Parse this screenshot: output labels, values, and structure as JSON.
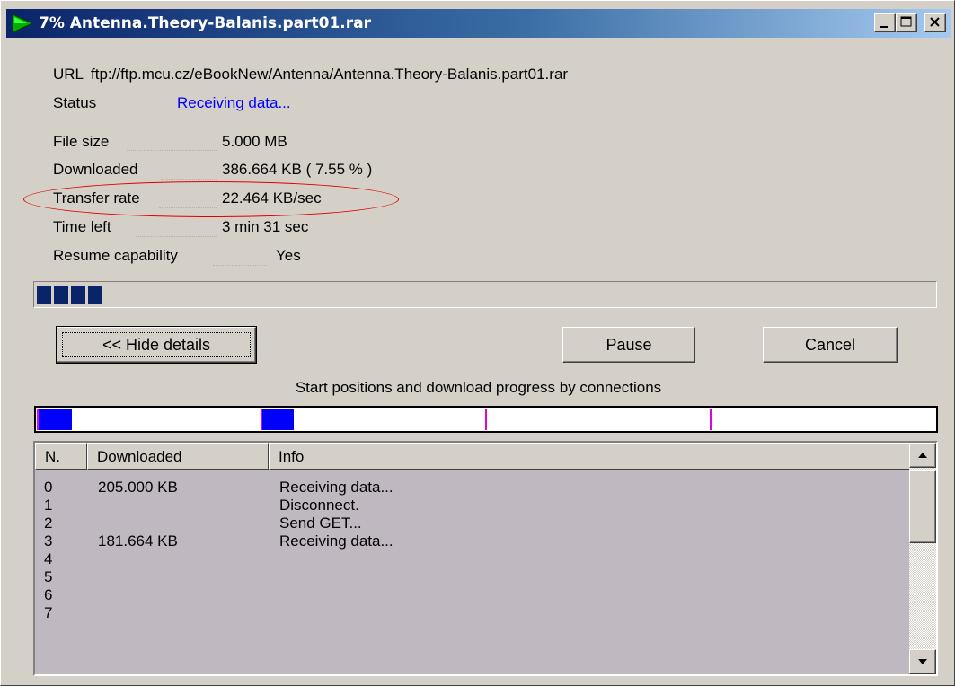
{
  "window": {
    "title": "7% Antenna.Theory-Balanis.part01.rar",
    "caption_buttons": [
      "minimize-icon",
      "maximize-icon",
      "close-icon"
    ]
  },
  "details": {
    "url_label": "URL",
    "url_value": "ftp://ftp.mcu.cz/eBookNew/Antenna/Antenna.Theory-Balanis.part01.rar",
    "status_label": "Status",
    "status_value": "Receiving data...",
    "status_color": "#0000ff",
    "file_size_label": "File size",
    "file_size_value": "5.000  MB",
    "downloaded_label": "Downloaded",
    "downloaded_value": "386.664  KB  ( 7.55 % )",
    "transfer_rate_label": "Transfer rate",
    "transfer_rate_value": "22.464  KB/sec",
    "time_left_label": "Time left",
    "time_left_value": "3 min 31 sec",
    "resume_label": "Resume capability",
    "resume_value": "Yes",
    "highlight_color": "#e00000"
  },
  "progress": {
    "percent": 7.55
  },
  "buttons": {
    "hide_details": "<< Hide details",
    "pause": "Pause",
    "cancel": "Cancel"
  },
  "connections_caption": "Start positions and download progress by connections",
  "connections_bar": {
    "segment_color": "#0000ff",
    "marker_color": "#e000e0"
  },
  "table": {
    "columns": [
      "N.",
      "Downloaded",
      "Info"
    ],
    "rows": [
      {
        "n": "0",
        "downloaded": "205.000  KB",
        "info": "Receiving data..."
      },
      {
        "n": "1",
        "downloaded": "",
        "info": "Disconnect."
      },
      {
        "n": "2",
        "downloaded": "",
        "info": "Send GET..."
      },
      {
        "n": "3",
        "downloaded": "181.664  KB",
        "info": "Receiving data..."
      },
      {
        "n": "4",
        "downloaded": "",
        "info": ""
      },
      {
        "n": "5",
        "downloaded": "",
        "info": ""
      },
      {
        "n": "6",
        "downloaded": "",
        "info": ""
      },
      {
        "n": "7",
        "downloaded": "",
        "info": ""
      }
    ]
  }
}
